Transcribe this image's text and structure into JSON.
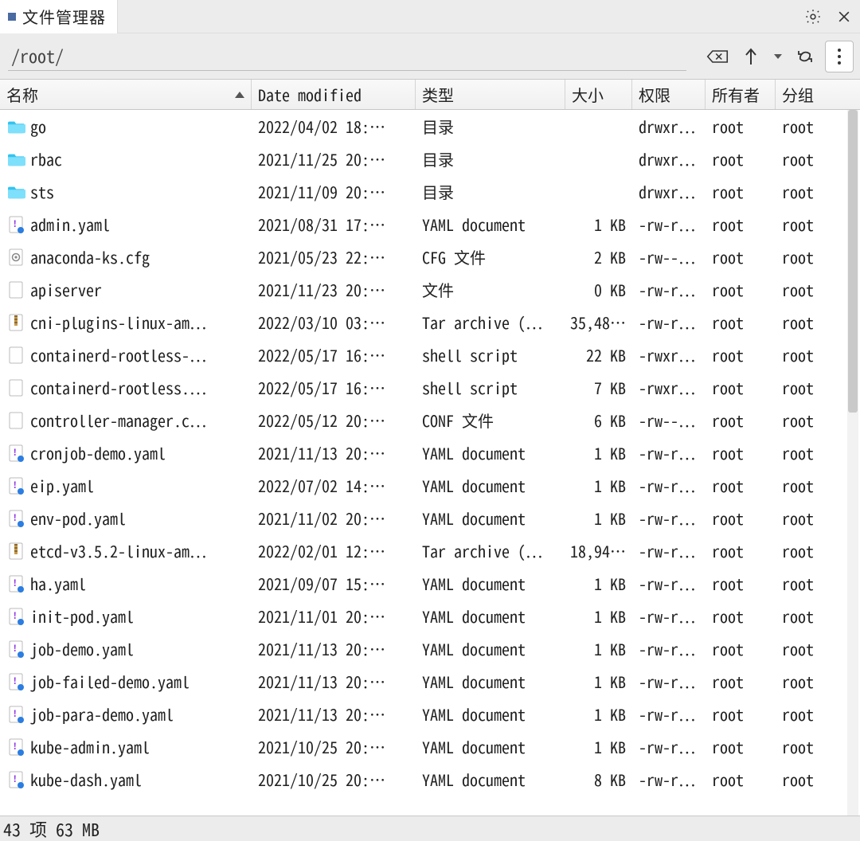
{
  "window": {
    "tab_title": "文件管理器"
  },
  "toolbar": {
    "path": "/root/"
  },
  "headers": {
    "name": "名称",
    "date": "Date modified",
    "type": "类型",
    "size": "大小",
    "perm": "权限",
    "owner": "所有者",
    "group": "分组"
  },
  "status": {
    "text": "43 项 63 MB"
  },
  "files": [
    {
      "icon": "folder",
      "name": "go",
      "date": "2022/04/02 18:…",
      "type": "目录",
      "size": "",
      "perm": "drwxr…",
      "owner": "root",
      "group": "root"
    },
    {
      "icon": "folder",
      "name": "rbac",
      "date": "2021/11/25 20:…",
      "type": "目录",
      "size": "",
      "perm": "drwxr…",
      "owner": "root",
      "group": "root"
    },
    {
      "icon": "folder",
      "name": "sts",
      "date": "2021/11/09 20:…",
      "type": "目录",
      "size": "",
      "perm": "drwxr…",
      "owner": "root",
      "group": "root"
    },
    {
      "icon": "yaml",
      "name": "admin.yaml",
      "date": "2021/08/31 17:…",
      "type": "YAML document",
      "size": "1 KB",
      "perm": "-rw-r…",
      "owner": "root",
      "group": "root"
    },
    {
      "icon": "cfg",
      "name": "anaconda-ks.cfg",
      "date": "2021/05/23 22:…",
      "type": "CFG 文件",
      "size": "2 KB",
      "perm": "-rw--…",
      "owner": "root",
      "group": "root"
    },
    {
      "icon": "file",
      "name": "apiserver",
      "date": "2021/11/23 20:…",
      "type": "文件",
      "size": "0 KB",
      "perm": "-rw-r…",
      "owner": "root",
      "group": "root"
    },
    {
      "icon": "tar",
      "name": "cni-plugins-linux-am…",
      "date": "2022/03/10 03:…",
      "type": "Tar archive (…",
      "size": "35,48…",
      "perm": "-rw-r…",
      "owner": "root",
      "group": "root"
    },
    {
      "icon": "file",
      "name": "containerd-rootless-…",
      "date": "2022/05/17 16:…",
      "type": "shell script",
      "size": "22 KB",
      "perm": "-rwxr…",
      "owner": "root",
      "group": "root"
    },
    {
      "icon": "file",
      "name": "containerd-rootless.…",
      "date": "2022/05/17 16:…",
      "type": "shell script",
      "size": "7 KB",
      "perm": "-rwxr…",
      "owner": "root",
      "group": "root"
    },
    {
      "icon": "file",
      "name": "controller-manager.c…",
      "date": "2022/05/12 20:…",
      "type": "CONF 文件",
      "size": "6 KB",
      "perm": "-rw--…",
      "owner": "root",
      "group": "root"
    },
    {
      "icon": "yaml",
      "name": "cronjob-demo.yaml",
      "date": "2021/11/13 20:…",
      "type": "YAML document",
      "size": "1 KB",
      "perm": "-rw-r…",
      "owner": "root",
      "group": "root"
    },
    {
      "icon": "yaml",
      "name": "eip.yaml",
      "date": "2022/07/02 14:…",
      "type": "YAML document",
      "size": "1 KB",
      "perm": "-rw-r…",
      "owner": "root",
      "group": "root"
    },
    {
      "icon": "yaml",
      "name": "env-pod.yaml",
      "date": "2021/11/02 20:…",
      "type": "YAML document",
      "size": "1 KB",
      "perm": "-rw-r…",
      "owner": "root",
      "group": "root"
    },
    {
      "icon": "tar",
      "name": "etcd-v3.5.2-linux-am…",
      "date": "2022/02/01 12:…",
      "type": "Tar archive (…",
      "size": "18,94…",
      "perm": "-rw-r…",
      "owner": "root",
      "group": "root"
    },
    {
      "icon": "yaml",
      "name": "ha.yaml",
      "date": "2021/09/07 15:…",
      "type": "YAML document",
      "size": "1 KB",
      "perm": "-rw-r…",
      "owner": "root",
      "group": "root"
    },
    {
      "icon": "yaml",
      "name": "init-pod.yaml",
      "date": "2021/11/01 20:…",
      "type": "YAML document",
      "size": "1 KB",
      "perm": "-rw-r…",
      "owner": "root",
      "group": "root"
    },
    {
      "icon": "yaml",
      "name": "job-demo.yaml",
      "date": "2021/11/13 20:…",
      "type": "YAML document",
      "size": "1 KB",
      "perm": "-rw-r…",
      "owner": "root",
      "group": "root"
    },
    {
      "icon": "yaml",
      "name": "job-failed-demo.yaml",
      "date": "2021/11/13 20:…",
      "type": "YAML document",
      "size": "1 KB",
      "perm": "-rw-r…",
      "owner": "root",
      "group": "root"
    },
    {
      "icon": "yaml",
      "name": "job-para-demo.yaml",
      "date": "2021/11/13 20:…",
      "type": "YAML document",
      "size": "1 KB",
      "perm": "-rw-r…",
      "owner": "root",
      "group": "root"
    },
    {
      "icon": "yaml",
      "name": "kube-admin.yaml",
      "date": "2021/10/25 20:…",
      "type": "YAML document",
      "size": "1 KB",
      "perm": "-rw-r…",
      "owner": "root",
      "group": "root"
    },
    {
      "icon": "yaml",
      "name": "kube-dash.yaml",
      "date": "2021/10/25 20:…",
      "type": "YAML document",
      "size": "8 KB",
      "perm": "-rw-r…",
      "owner": "root",
      "group": "root"
    }
  ]
}
